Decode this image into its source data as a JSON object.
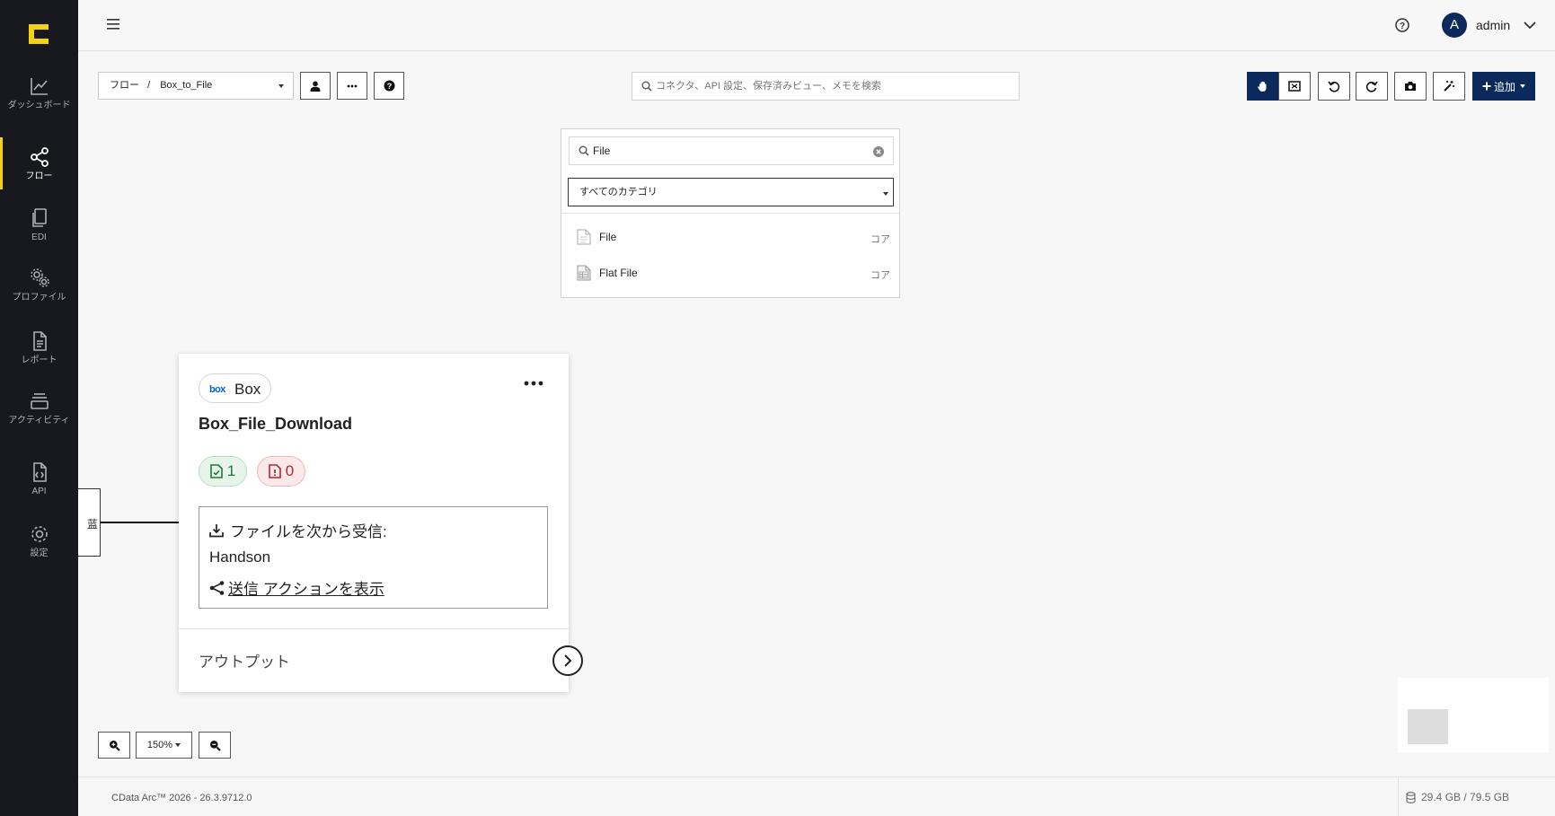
{
  "sidebar": {
    "logo": "c-logo-icon",
    "items": [
      {
        "label": "ダッシュボード",
        "icon": "chart-line-icon"
      },
      {
        "label": "フロー",
        "icon": "share-nodes-icon",
        "active": true
      },
      {
        "label": "EDI",
        "icon": "documents-icon"
      },
      {
        "label": "プロファイル",
        "icon": "gears-icon"
      },
      {
        "label": "レポート",
        "icon": "report-icon"
      },
      {
        "label": "アクティビティ",
        "icon": "layers-icon"
      },
      {
        "label": "API",
        "icon": "api-file-icon"
      },
      {
        "label": "設定",
        "icon": "gear-icon"
      }
    ]
  },
  "header": {
    "user_initial": "A",
    "user_name": "admin"
  },
  "toolbar": {
    "breadcrumb_root": "フロー",
    "breadcrumb_sep": "/",
    "breadcrumb_flow": "Box_to_File",
    "search_placeholder": "コネクタ、API 設定、保存済みビュー、メモを検索",
    "add_label": "追加"
  },
  "picker": {
    "search_value": "File",
    "category_select": "すべてのカテゴリ",
    "results": [
      {
        "name": "File",
        "category": "コア",
        "icon": "file-icon"
      },
      {
        "name": "Flat File",
        "category": "コア",
        "icon": "flat-file-icon"
      }
    ]
  },
  "node": {
    "connector_type": "Box",
    "left_node_fragment": "蓝",
    "name": "Box_File_Download",
    "success_count": "1",
    "error_count": "0",
    "receive_label": "ファイルを次から受信:",
    "receive_source": "Handson",
    "send_actions_label": "送信 アクションを表示",
    "output_label": "アウトプット"
  },
  "zoom": {
    "level": "150%"
  },
  "footer": {
    "version": "CData Arc™ 2026 - 26.3.9712.0",
    "storage": "29.4 GB / 79.5 GB"
  },
  "colors": {
    "sidebar_bg": "#17191e",
    "accent_yellow": "#f5d10e",
    "primary_navy": "#0b2a5b",
    "success_green": "#1e7a3c",
    "error_red": "#b3262f"
  }
}
